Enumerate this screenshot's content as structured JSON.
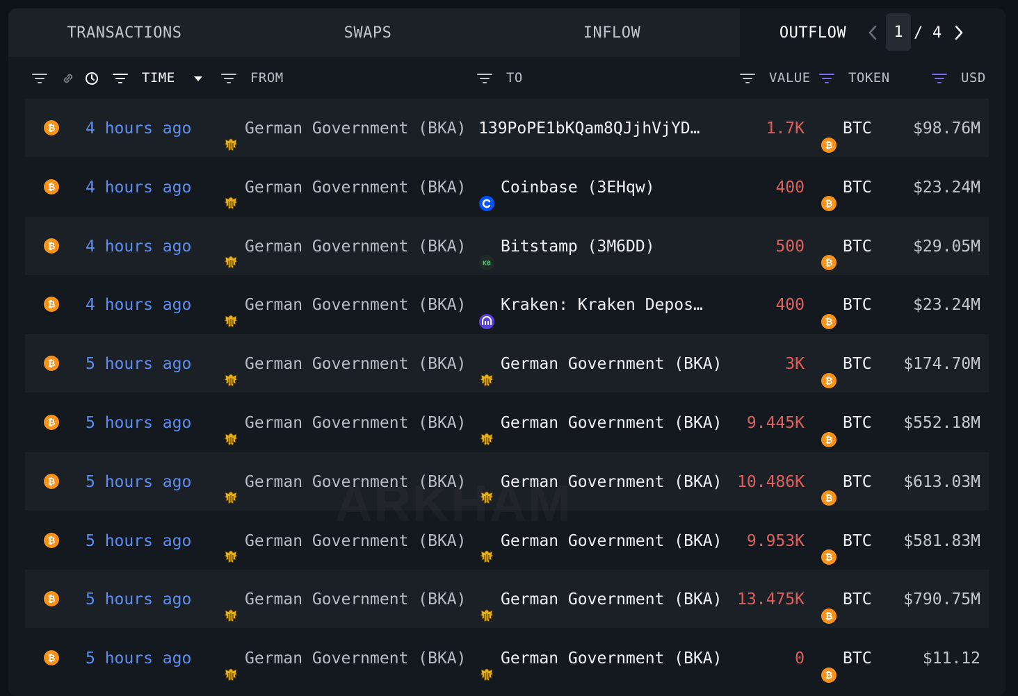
{
  "tabs": [
    {
      "label": "TRANSACTIONS"
    },
    {
      "label": "SWAPS"
    },
    {
      "label": "INFLOW"
    },
    {
      "label": "OUTFLOW"
    }
  ],
  "pagination": {
    "current": "1",
    "separator": "/",
    "total": "4"
  },
  "columns": {
    "time": "TIME",
    "from": "FROM",
    "to": "TO",
    "value": "VALUE",
    "token": "TOKEN",
    "usd": "USD"
  },
  "colors": {
    "time_link": "#5d8ef0",
    "value_negative": "#e0605c",
    "btc_orange": "#f7931a",
    "token_filter_accent": "#7b68ee"
  },
  "watermark": "ARKHAM",
  "rows": [
    {
      "time": "4 hours ago",
      "from": "German Government (BKA)",
      "from_icon": "german-eagle-icon",
      "to": "139PoPE1bKQam8QJjhVjYD…",
      "to_icon": "",
      "value": "1.7K",
      "token": "BTC",
      "usd": "$98.76M"
    },
    {
      "time": "4 hours ago",
      "from": "German Government (BKA)",
      "from_icon": "german-eagle-icon",
      "to": "Coinbase (3EHqw)",
      "to_icon": "coinbase-icon",
      "value": "400",
      "token": "BTC",
      "usd": "$23.24M"
    },
    {
      "time": "4 hours ago",
      "from": "German Government (BKA)",
      "from_icon": "german-eagle-icon",
      "to": "Bitstamp (3M6DD)",
      "to_icon": "bitstamp-icon",
      "value": "500",
      "token": "BTC",
      "usd": "$29.05M"
    },
    {
      "time": "4 hours ago",
      "from": "German Government (BKA)",
      "from_icon": "german-eagle-icon",
      "to": "Kraken: Kraken Depos…",
      "to_icon": "kraken-icon",
      "value": "400",
      "token": "BTC",
      "usd": "$23.24M"
    },
    {
      "time": "5 hours ago",
      "from": "German Government (BKA)",
      "from_icon": "german-eagle-icon",
      "to": "German Government (BKA)",
      "to_icon": "german-eagle-icon",
      "value": "3K",
      "token": "BTC",
      "usd": "$174.70M"
    },
    {
      "time": "5 hours ago",
      "from": "German Government (BKA)",
      "from_icon": "german-eagle-icon",
      "to": "German Government (BKA)",
      "to_icon": "german-eagle-icon",
      "value": "9.445K",
      "token": "BTC",
      "usd": "$552.18M"
    },
    {
      "time": "5 hours ago",
      "from": "German Government (BKA)",
      "from_icon": "german-eagle-icon",
      "to": "German Government (BKA)",
      "to_icon": "german-eagle-icon",
      "value": "10.486K",
      "token": "BTC",
      "usd": "$613.03M"
    },
    {
      "time": "5 hours ago",
      "from": "German Government (BKA)",
      "from_icon": "german-eagle-icon",
      "to": "German Government (BKA)",
      "to_icon": "german-eagle-icon",
      "value": "9.953K",
      "token": "BTC",
      "usd": "$581.83M"
    },
    {
      "time": "5 hours ago",
      "from": "German Government (BKA)",
      "from_icon": "german-eagle-icon",
      "to": "German Government (BKA)",
      "to_icon": "german-eagle-icon",
      "value": "13.475K",
      "token": "BTC",
      "usd": "$790.75M"
    },
    {
      "time": "5 hours ago",
      "from": "German Government (BKA)",
      "from_icon": "german-eagle-icon",
      "to": "German Government (BKA)",
      "to_icon": "german-eagle-icon",
      "value": "0",
      "token": "BTC",
      "usd": "$11.12"
    }
  ]
}
